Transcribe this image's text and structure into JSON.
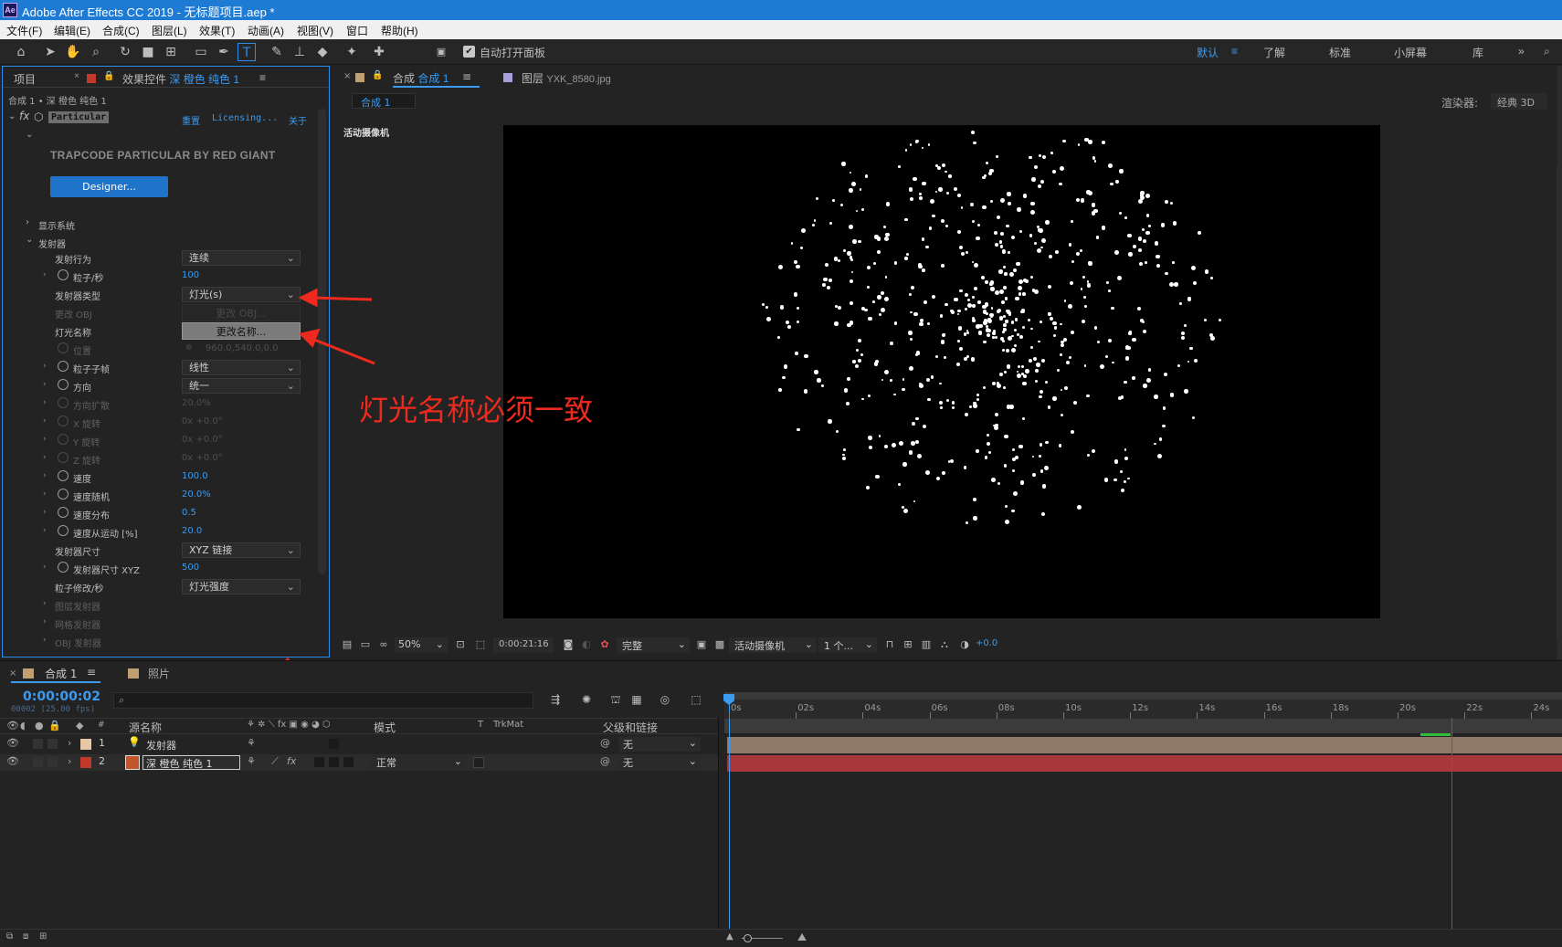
{
  "window": {
    "title": "Adobe After Effects CC 2019 - 无标题项目.aep *",
    "logo": "Ae"
  },
  "menu": [
    "文件(F)",
    "编辑(E)",
    "合成(C)",
    "图层(L)",
    "效果(T)",
    "动画(A)",
    "视图(V)",
    "窗口",
    "帮助(H)"
  ],
  "toolbar": {
    "tools": [
      "home-icon",
      "selection-tool-icon",
      "hand-tool-icon",
      "zoom-tool-icon",
      "rotate-tool-icon",
      "camera-tool-icon",
      "pan-behind-tool-icon",
      "rectangle-tool-icon",
      "pen-tool-icon",
      "type-tool-icon",
      "brush-tool-icon",
      "clone-stamp-icon",
      "eraser-icon",
      "roto-brush-icon",
      "puppet-pin-icon"
    ],
    "auto_open_label": "自动打开面板",
    "workspaces": [
      "默认",
      "了解",
      "标准",
      "小屏幕",
      "库"
    ],
    "active_workspace": "默认"
  },
  "left_panel": {
    "tab_project": "项目",
    "tab_effects_prefix": "效果控件",
    "tab_effects_layer": "深 橙色 纯色 1",
    "breadcrumb": "合成 1 • 深 橙色 纯色 1",
    "effect_name": "Particular",
    "effect_reset": "重置",
    "effect_licensing": "Licensing...",
    "effect_about": "关于",
    "brand": "TRAPCODE PARTICULAR BY RED GIANT",
    "designer_button": "Designer...",
    "show_system": "显示系统",
    "emitter_group": "发射器",
    "rows": [
      {
        "label": "发射行为",
        "kind": "dropdown",
        "value": "连续",
        "twirl": false,
        "stopwatch": false,
        "dim": false
      },
      {
        "label": "粒子/秒",
        "kind": "number",
        "value": "100",
        "twirl": true,
        "stopwatch": true,
        "dim": false
      },
      {
        "label": "发射器类型",
        "kind": "dropdown",
        "value": "灯光(s)",
        "twirl": false,
        "stopwatch": false,
        "dim": false
      },
      {
        "label": "更改 OBJ",
        "kind": "button",
        "value": "更改 OBJ...",
        "twirl": false,
        "stopwatch": false,
        "dim": true
      },
      {
        "label": "灯光名称",
        "kind": "button",
        "value": "更改名称...",
        "twirl": false,
        "stopwatch": false,
        "dim": false
      },
      {
        "label": "位置",
        "kind": "number",
        "value": "960.0,540.0,0.0",
        "twirl": false,
        "stopwatch": true,
        "dim": true
      },
      {
        "label": "粒子子帧",
        "kind": "dropdown",
        "value": "线性",
        "twirl": true,
        "stopwatch": true,
        "dim": false
      },
      {
        "label": "方向",
        "kind": "dropdown",
        "value": "统一",
        "twirl": true,
        "stopwatch": true,
        "dim": false
      },
      {
        "label": "方向扩散",
        "kind": "number",
        "value": "20.0%",
        "twirl": true,
        "stopwatch": true,
        "dim": true
      },
      {
        "label": "X 旋转",
        "kind": "number",
        "value": "0x +0.0°",
        "twirl": true,
        "stopwatch": true,
        "dim": true
      },
      {
        "label": "Y 旋转",
        "kind": "number",
        "value": "0x +0.0°",
        "twirl": true,
        "stopwatch": true,
        "dim": true
      },
      {
        "label": "Z 旋转",
        "kind": "number",
        "value": "0x +0.0°",
        "twirl": true,
        "stopwatch": true,
        "dim": true
      },
      {
        "label": "速度",
        "kind": "number",
        "value": "100.0",
        "twirl": true,
        "stopwatch": true,
        "dim": false
      },
      {
        "label": "速度随机",
        "kind": "number",
        "value": "20.0%",
        "twirl": true,
        "stopwatch": true,
        "dim": false
      },
      {
        "label": "速度分布",
        "kind": "number",
        "value": "0.5",
        "twirl": true,
        "stopwatch": true,
        "dim": false
      },
      {
        "label": "速度从运动 [%]",
        "kind": "number",
        "value": "20.0",
        "twirl": true,
        "stopwatch": true,
        "dim": false
      },
      {
        "label": "发射器尺寸",
        "kind": "dropdown",
        "value": "XYZ 链接",
        "twirl": false,
        "stopwatch": false,
        "dim": false
      },
      {
        "label": "发射器尺寸 XYZ",
        "kind": "number",
        "value": "500",
        "twirl": true,
        "stopwatch": true,
        "dim": false
      },
      {
        "label": "粒子修改/秒",
        "kind": "dropdown",
        "value": "灯光强度",
        "twirl": false,
        "stopwatch": false,
        "dim": false
      },
      {
        "label": "图层发射器",
        "kind": "group",
        "value": "",
        "twirl": true,
        "stopwatch": false,
        "dim": true
      },
      {
        "label": "网格发射器",
        "kind": "group",
        "value": "",
        "twirl": true,
        "stopwatch": false,
        "dim": true
      },
      {
        "label": "OBJ 发射器",
        "kind": "group",
        "value": "",
        "twirl": true,
        "stopwatch": false,
        "dim": true
      }
    ]
  },
  "viewer": {
    "tab_comp_prefix": "合成",
    "tab_comp_name": "合成 1",
    "tab_layer": "图层",
    "tab_layer_name": "YXK_8580.jpg",
    "breadcrumb": "合成 1",
    "renderer_label": "渲染器:",
    "renderer_value": "经典 3D",
    "camera_label": "活动摄像机",
    "zoom": "50%",
    "timecode": "0:00:21:16",
    "resolution": "完整",
    "view_camera": "活动摄像机",
    "views": "1 个...",
    "exposure": "+0.0",
    "annotation": "灯光名称必须一致"
  },
  "timeline": {
    "tab_comp": "合成 1",
    "tab_photo": "照片",
    "timecode": "0:00:00:02",
    "frame_info": "00002 (25.00 fps)",
    "search_placeholder": "",
    "col_source": "源名称",
    "col_mode": "模式",
    "col_t": "T",
    "col_trkmat": "TrkMat",
    "col_parent": "父级和链接",
    "col_num": "#",
    "layers": [
      {
        "index": "1",
        "name": "发射器",
        "color": "#e7c8a6",
        "mode": "",
        "parent": "无",
        "type": "light"
      },
      {
        "index": "2",
        "name": "深 橙色 纯色 1",
        "color": "#c0392b",
        "mode": "正常",
        "parent": "无",
        "type": "solid"
      }
    ],
    "ruler": [
      "0s",
      "02s",
      "04s",
      "06s",
      "08s",
      "10s",
      "12s",
      "14s",
      "16s",
      "18s",
      "20s",
      "22s",
      "24s"
    ]
  },
  "colors": {
    "accent": "#2d8ceb",
    "annotation": "#ee2a1f",
    "layer1_bar": "#8f7a6a",
    "layer2_bar": "#a8373a",
    "work_area": "#2fbe3b"
  }
}
